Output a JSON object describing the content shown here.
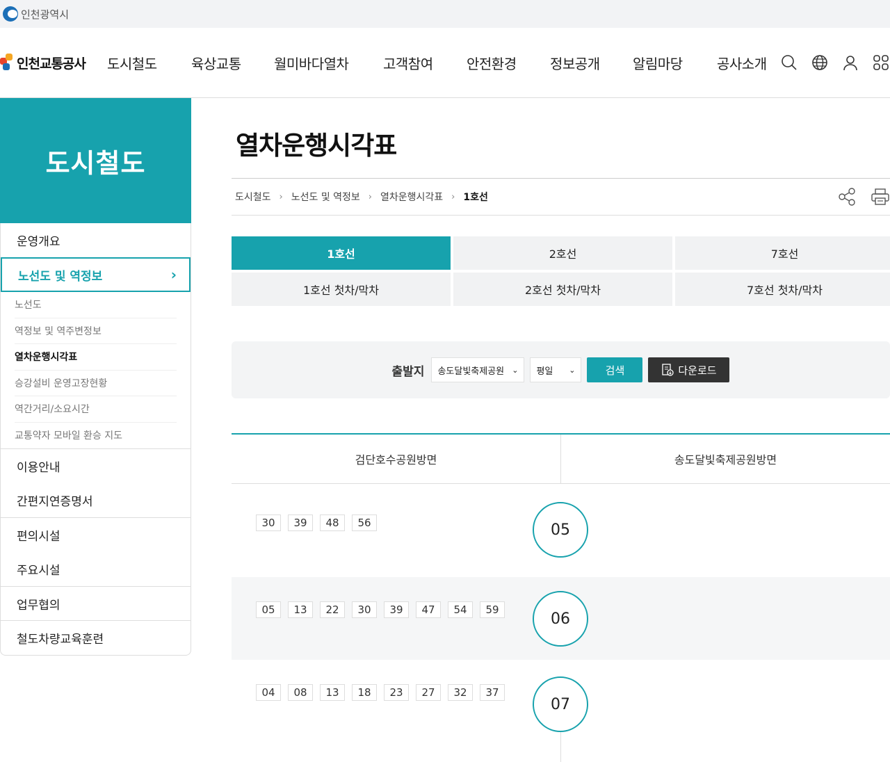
{
  "top": {
    "city": "인천광역시"
  },
  "header": {
    "brand": "인천교통공사",
    "menu": [
      "도시철도",
      "육상교통",
      "월미바다열차",
      "고객참여",
      "안전환경",
      "정보공개",
      "알림마당",
      "공사소개"
    ]
  },
  "sidebar": {
    "title": "도시철도",
    "items_top": [
      "운영개요"
    ],
    "active": "노선도 및 역정보",
    "sub": [
      "노선도",
      "역정보 및 역주변정보",
      "열차운행시각표",
      "승강설비 운영고장현황",
      "역간거리/소요시간",
      "교통약자 모바일 환승 지도"
    ],
    "group1": [
      "이용안내",
      "간편지연증명서"
    ],
    "group2": [
      "편의시설",
      "주요시설"
    ],
    "group3": [
      "업무협의",
      "철도차량교육훈련"
    ]
  },
  "page": {
    "title": "열차운행시각표",
    "breadcrumb": [
      "도시철도",
      "노선도 및 역정보",
      "열차운행시각표",
      "1호선"
    ]
  },
  "tabs": {
    "row1": [
      "1호선",
      "2호선",
      "7호선"
    ],
    "row2": [
      "1호선 첫차/막차",
      "2호선 첫차/막차",
      "7호선 첫차/막차"
    ]
  },
  "search": {
    "label": "출발지",
    "station": "송도달빛축제공원",
    "daytype": "평일",
    "search_btn": "검색",
    "download_btn": "다운로드"
  },
  "timetable": {
    "col_left": "검단호수공원방면",
    "col_right": "송도달빛축제공원방면",
    "rows": [
      {
        "hour": "05",
        "mins": [
          "30",
          "39",
          "48",
          "56"
        ]
      },
      {
        "hour": "06",
        "mins": [
          "05",
          "13",
          "22",
          "30",
          "39",
          "47",
          "54",
          "59"
        ]
      },
      {
        "hour": "07",
        "mins": [
          "04",
          "08",
          "13",
          "18",
          "23",
          "27",
          "32",
          "37"
        ]
      }
    ]
  },
  "colors": {
    "accent": "#17a2ad",
    "dark_button": "#333333"
  }
}
